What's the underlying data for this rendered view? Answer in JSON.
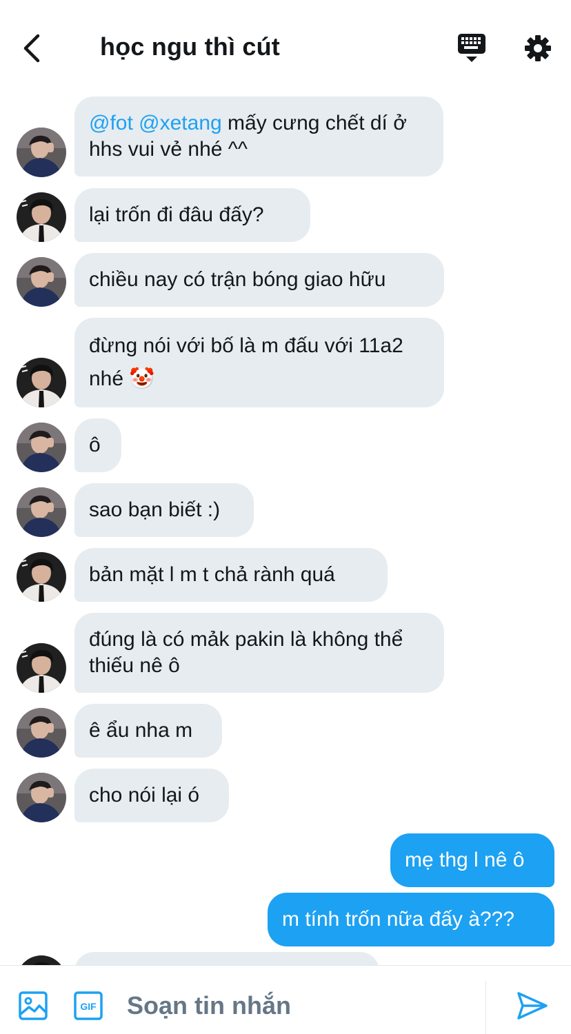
{
  "header": {
    "title": "học ngu thì cút",
    "back_icon": "chevron-left-icon",
    "keyboard_icon": "keyboard-icon",
    "settings_icon": "gear-icon"
  },
  "messages": [
    {
      "sender": "avatar-a",
      "direction": "in",
      "mentions": [
        "@fot",
        "@xetang"
      ],
      "text": "mấy cưng chết dí ở hhs vui vẻ nhé ^^"
    },
    {
      "sender": "avatar-b",
      "direction": "in",
      "text": "lại trốn đi đâu đấy?"
    },
    {
      "sender": "avatar-a",
      "direction": "in",
      "text": "chiều nay có trận bóng giao hữu"
    },
    {
      "sender": "avatar-b",
      "direction": "in",
      "text": "đừng nói với bố là m đấu với 11a2 nhé 🤡"
    },
    {
      "sender": "avatar-a",
      "direction": "in",
      "text": "ô"
    },
    {
      "sender": "avatar-a",
      "direction": "in",
      "text": "sao bạn biết :)"
    },
    {
      "sender": "avatar-b",
      "direction": "in",
      "text": "bản mặt l m t chả rành quá"
    },
    {
      "sender": "avatar-b",
      "direction": "in",
      "text": "đúng là có mảk pakin là không thể thiếu nê ô"
    },
    {
      "sender": "avatar-a",
      "direction": "in",
      "text": "ê ẩu nha m"
    },
    {
      "sender": "avatar-a",
      "direction": "in",
      "text": "cho nói lại ó"
    },
    {
      "sender": "me",
      "direction": "out",
      "text": "mẹ thg l nê ô"
    },
    {
      "sender": "me",
      "direction": "out",
      "text": "m tính trốn nữa đấy à???"
    }
  ],
  "compose": {
    "placeholder": "Soạn tin nhắn",
    "media_icon": "image-icon",
    "gif_icon": "gif-icon",
    "gif_label": "GIF",
    "send_icon": "send-icon"
  },
  "colors": {
    "accent": "#1da1f2",
    "bubble_in": "#e6ecf0",
    "text": "#14171a",
    "muted": "#657786"
  }
}
